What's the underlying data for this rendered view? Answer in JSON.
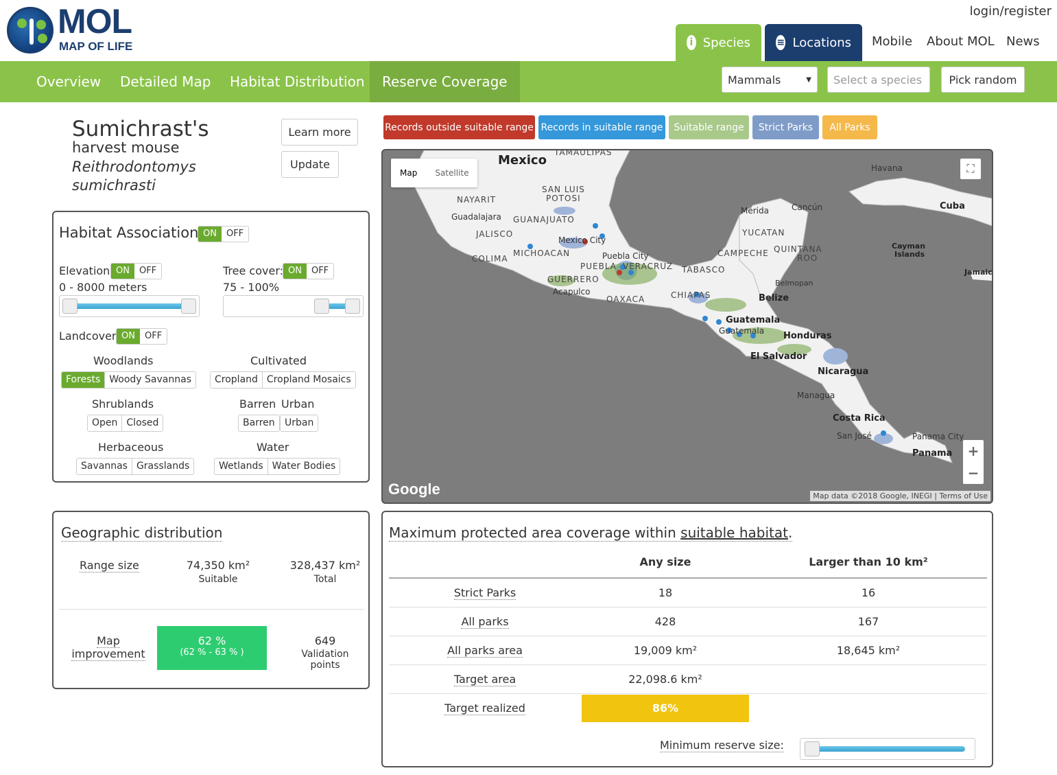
{
  "header": {
    "logo_title": "MOL",
    "logo_subtitle": "MAP OF LIFE",
    "login": "login/register",
    "tabs": [
      {
        "label": "Species",
        "icon": "info-icon"
      },
      {
        "label": "Locations",
        "icon": "list-icon"
      }
    ],
    "links": [
      "Mobile",
      "About MOL",
      "News"
    ]
  },
  "nav": {
    "items": [
      "Overview",
      "Detailed Map",
      "Habitat Distribution",
      "Reserve Coverage"
    ],
    "active": "Reserve Coverage",
    "group_select": "Mammals",
    "species_placeholder": "Select a species",
    "pick_random": "Pick random"
  },
  "species": {
    "common_line1": "Sumichrast's",
    "common_line2": "harvest mouse",
    "scientific": "Reithrodontomys sumichrasti",
    "learn_more": "Learn more",
    "update": "Update"
  },
  "habitat": {
    "title": "Habitat Associations",
    "on": "ON",
    "off": "OFF",
    "elevation_label": "Elevation",
    "elevation_range": "0 - 8000 meters",
    "elevation_slider": [
      0,
      8000
    ],
    "tree_label": "Tree cover:",
    "tree_range": "75 - 100%",
    "tree_slider": [
      75,
      100
    ],
    "landcover_label": "Landcover",
    "groups": {
      "woodlands": {
        "title": "Woodlands",
        "items": [
          "Forests",
          "Woody Savannas"
        ],
        "selected": "Forests"
      },
      "cultivated": {
        "title": "Cultivated",
        "items": [
          "Cropland",
          "Cropland Mosaics"
        ]
      },
      "shrublands": {
        "title": "Shrublands",
        "items": [
          "Open",
          "Closed"
        ]
      },
      "barren_title": "Barren",
      "urban_title": "Urban",
      "barren_urban": {
        "items": [
          "Barren",
          "Urban"
        ]
      },
      "herbaceous": {
        "title": "Herbaceous",
        "items": [
          "Savannas",
          "Grasslands"
        ]
      },
      "water": {
        "title": "Water",
        "items": [
          "Wetlands",
          "Water Bodies"
        ]
      }
    }
  },
  "legend": [
    {
      "label": "Records outside suitable range",
      "color": "#c0392b"
    },
    {
      "label": "Records in suitable range",
      "color": "#3498db"
    },
    {
      "label": "Suitable range",
      "color": "#a9c98a"
    },
    {
      "label": "Strict Parks",
      "color": "#7f9cc9"
    },
    {
      "label": "All Parks",
      "color": "#f5b84a"
    }
  ],
  "map": {
    "tab_map": "Map",
    "tab_satellite": "Satellite",
    "attribution": "Map data ©2018 Google, INEGI",
    "terms": "Terms of Use",
    "google": "Google",
    "zoom_in": "+",
    "zoom_out": "−",
    "labels": {
      "mexico": "Mexico",
      "tamaulipas": "TAMAULIPAS",
      "san_luis": "SAN LUIS",
      "potosi": "POTOSI",
      "nayarit": "NAYARIT",
      "guadalajara": "Guadalajara",
      "guanajuato": "GUANAJUATO",
      "jalisco": "JALISCO",
      "colima": "COLIMA",
      "michoacan": "MICHOACAN",
      "mexico_city": "Mexico City",
      "puebla_city": "Puebla City",
      "puebla": "PUEBLA",
      "veracruz": "VERACRUZ",
      "guerrero": "GUERRERO",
      "acapulco": "Acapulco",
      "oaxaca": "OAXACA",
      "chiapas": "CHIAPAS",
      "tabasco": "TABASCO",
      "campeche": "CAMPECHE",
      "yucatan": "YUCATAN",
      "merida": "Mérida",
      "cancun": "Cancún",
      "quintana": "QUINTANA",
      "roo": "ROO",
      "belmopan": "Belmopan",
      "belize": "Belize",
      "havana": "Havana",
      "cuba": "Cuba",
      "cayman": "Cayman",
      "islands": "Islands",
      "jamaica": "Jamaic",
      "guatemala": "Guatemala",
      "guatemala_city": "Guatemala",
      "honduras": "Honduras",
      "el_salvador": "El Salvador",
      "nicaragua": "Nicaragua",
      "managua": "Managua",
      "costa_rica": "Costa Rica",
      "san_jose": "San José",
      "panama_city": "Panama City",
      "panama": "Panama"
    }
  },
  "geo": {
    "title": "Geographic distribution",
    "range_label": "Range size",
    "suitable_value": "74,350 km²",
    "suitable_label": "Suitable",
    "total_value": "328,437 km²",
    "total_label": "Total",
    "map_improvement_label": "Map improvement",
    "improvement_value": "62 %",
    "improvement_range": "(62 %  -  63 % )",
    "validation_value": "649",
    "validation_label": "Validation points"
  },
  "coverage": {
    "title_prefix": "Maximum protected area coverage within ",
    "title_link": "suitable habitat",
    "title_suffix": ".",
    "col_any": "Any size",
    "col_large": "Larger than 10 km²",
    "rows": [
      {
        "label": "Strict Parks",
        "any": "18",
        "large": "16"
      },
      {
        "label": "All parks",
        "any": "428",
        "large": "167"
      },
      {
        "label": "All parks area",
        "any": "19,009 km²",
        "large": "18,645 km²"
      },
      {
        "label": "Target area",
        "any": "22,098.6 km²",
        "large": ""
      }
    ],
    "target_label": "Target realized",
    "target_value": "86%",
    "target_fraction": 0.86,
    "min_reserve_label": "Minimum reserve size:"
  }
}
